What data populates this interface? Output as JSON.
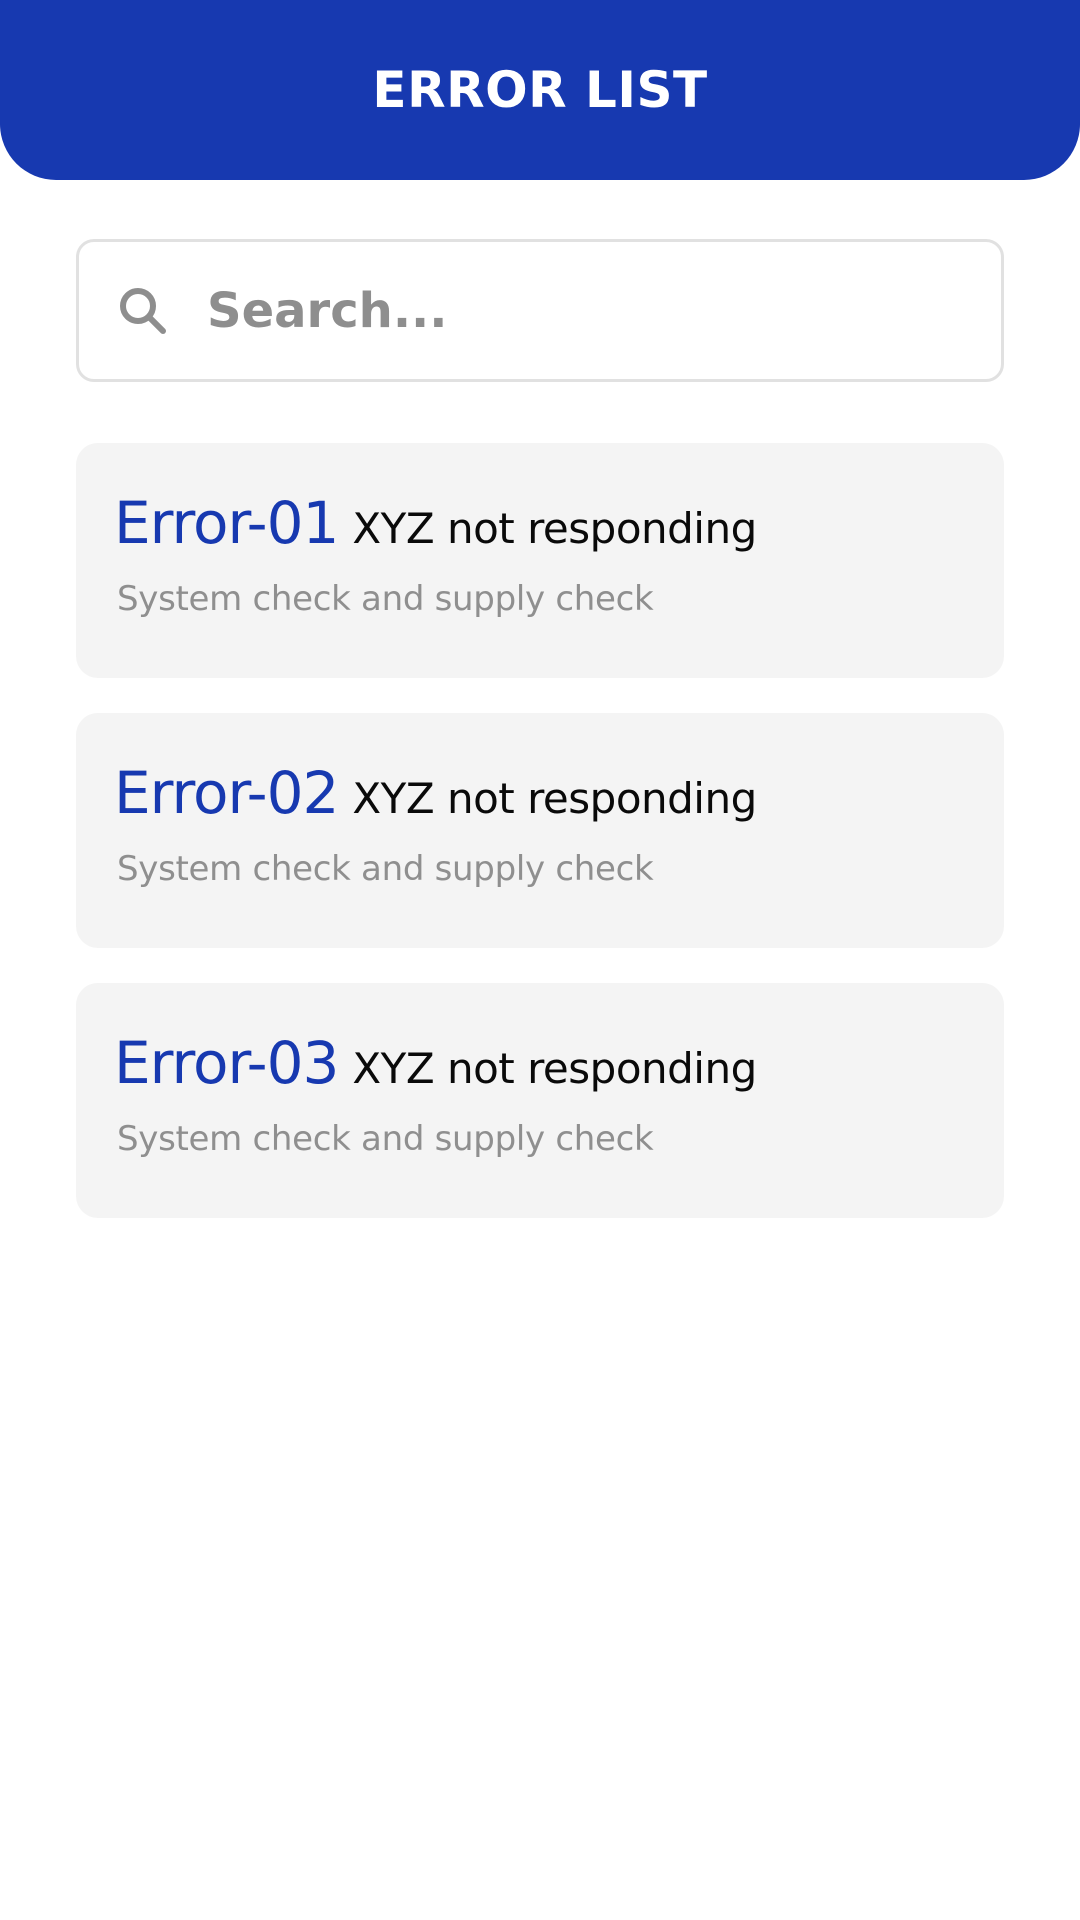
{
  "header": {
    "title": "ERROR LIST"
  },
  "search": {
    "placeholder": "Search...",
    "value": "",
    "icon": "search-icon"
  },
  "errors": [
    {
      "code": "Error-01",
      "title": "XYZ not responding",
      "description": "System check and supply check"
    },
    {
      "code": "Error-02",
      "title": "XYZ not responding",
      "description": "System check and supply check"
    },
    {
      "code": "Error-03",
      "title": "XYZ not responding",
      "description": "System check and supply check"
    }
  ],
  "colors": {
    "accent": "#1739b0",
    "card_background": "#f4f4f4",
    "secondary_text": "#8f8f8f"
  }
}
